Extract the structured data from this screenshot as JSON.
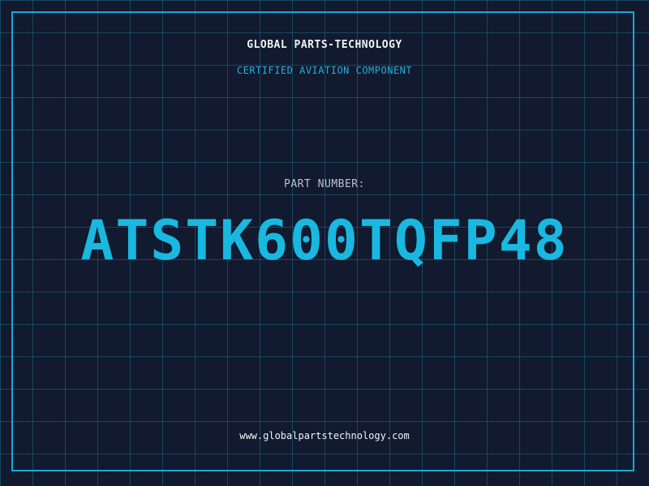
{
  "header": {
    "company_name": "GLOBAL PARTS-TECHNOLOGY",
    "subtitle": "CERTIFIED AVIATION COMPONENT"
  },
  "part": {
    "label": "PART NUMBER:",
    "number": "ATSTK600TQFP48"
  },
  "footer": {
    "website": "www.globalpartstechnology.com"
  },
  "colors": {
    "background": "#111a2e",
    "grid": "#227da0",
    "accent": "#19b8e0",
    "text": "#f1f4f8",
    "muted": "#b9c2d0"
  }
}
